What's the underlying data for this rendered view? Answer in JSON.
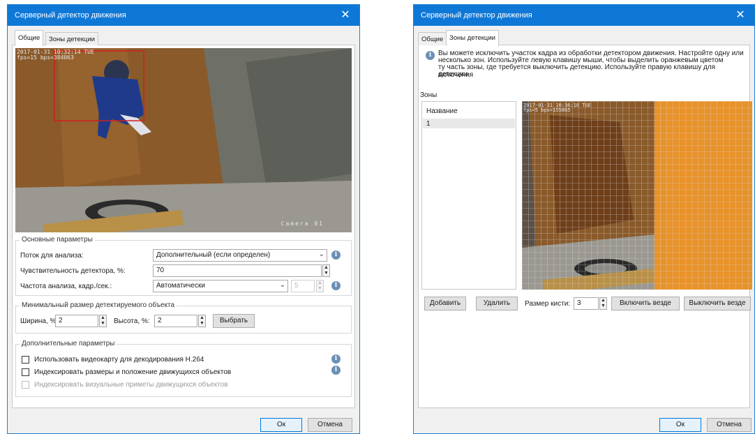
{
  "left_dialog": {
    "title": "Серверный детектор движения",
    "tabs": [
      "Общие",
      "Зоны детекции"
    ],
    "camera": {
      "timestamp": "2017-01-31 10:32:14 TUE",
      "stats": "fps=15 bps=384063",
      "label": "Camera 01"
    },
    "basic": {
      "title": "Основные параметры",
      "stream_label": "Поток для анализа:",
      "stream_value": "Дополнительный (если определен)",
      "sensitivity_label": "Чувствительность детектора, %:",
      "sensitivity_value": "70",
      "frequency_label": "Частота анализа, кадр./сек.:",
      "frequency_value": "Автоматически",
      "frequency_number": "5"
    },
    "min_size": {
      "title": "Минимальный размер детектируемого объекта",
      "width_label": "Ширина, %:",
      "width_value": "2",
      "height_label": "Высота, %:",
      "height_value": "2",
      "select_button": "Выбрать"
    },
    "extra": {
      "title": "Дополнительные параметры",
      "opt1": "Использовать видеокарту для декодирования H.264",
      "opt2": "Индексировать размеры и положение движущихся объектов",
      "opt3": "Индексировать визуальные приметы движущихся объектов"
    },
    "ok": "Ок",
    "cancel": "Отмена"
  },
  "right_dialog": {
    "title": "Серверный детектор движения",
    "tabs": [
      "Общие",
      "Зоны детекции"
    ],
    "info_line1": "Вы можете исключить участок кадра из обработки детектором движения. Настройте одну или",
    "info_line2": "несколько зон. Используйте левую клавишу мыши, чтобы выделить оранжевым цветом",
    "info_line3": "ту часть зоны, где требуется выключить детекцию. Используйте правую клавишу для включения",
    "info_line4": "детекции.",
    "zones_label": "Зоны",
    "list_header": "Название",
    "zones": [
      "1"
    ],
    "camera": {
      "timestamp": "2017-01-31 10:36:10 TUE",
      "stats": "fps=5 bps=155865"
    },
    "add_button": "Добавить",
    "delete_button": "Удалить",
    "brush_label": "Размер кисти:",
    "brush_value": "3",
    "enable_all": "Включить везде",
    "disable_all": "Выключить везде",
    "ok": "Ок",
    "cancel": "Отмена"
  },
  "colors": {
    "title_bar": "#0f78d7",
    "zone_orange": "#e8922a",
    "motion_box": "#d02020"
  }
}
